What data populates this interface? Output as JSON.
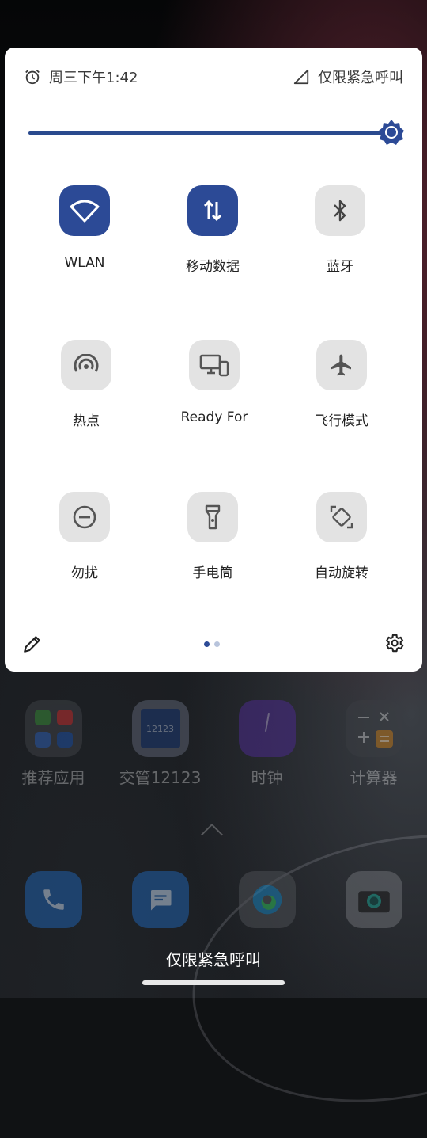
{
  "status_bar": {
    "time": "周三下午1:42",
    "network_status": "仅限紧急呼叫",
    "alarm_icon": "alarm-clock-icon",
    "signal_icon": "signal-icon"
  },
  "brightness": {
    "level": 1.0,
    "icon": "brightness-icon"
  },
  "tiles": [
    {
      "label": "WLAN",
      "icon": "wifi-icon",
      "active": true
    },
    {
      "label": "移动数据",
      "icon": "mobile-data-icon",
      "active": true
    },
    {
      "label": "蓝牙",
      "icon": "bluetooth-icon",
      "active": false
    },
    {
      "label": "热点",
      "icon": "hotspot-icon",
      "active": false
    },
    {
      "label": "Ready For",
      "icon": "ready-for-icon",
      "active": false
    },
    {
      "label": "飞行模式",
      "icon": "airplane-icon",
      "active": false
    },
    {
      "label": "勿扰",
      "icon": "do-not-disturb-icon",
      "active": false
    },
    {
      "label": "手电筒",
      "icon": "flashlight-icon",
      "active": false
    },
    {
      "label": "自动旋转",
      "icon": "auto-rotate-icon",
      "active": false
    }
  ],
  "footer": {
    "edit_icon": "pencil-icon",
    "settings_icon": "gear-icon",
    "page_current": 1,
    "page_count": 2
  },
  "home_apps": [
    {
      "label": "推荐应用"
    },
    {
      "label": "交管12123",
      "icon_text": "12123"
    },
    {
      "label": "时钟"
    },
    {
      "label": "计算器"
    }
  ],
  "dock": [
    {
      "icon": "phone-icon"
    },
    {
      "icon": "messages-icon"
    },
    {
      "icon": "edge-browser-icon"
    },
    {
      "icon": "camera-icon"
    }
  ],
  "emergency_text": "仅限紧急呼叫",
  "colors": {
    "accent": "#2c4a96",
    "tile_inactive": "#e3e3e3"
  }
}
